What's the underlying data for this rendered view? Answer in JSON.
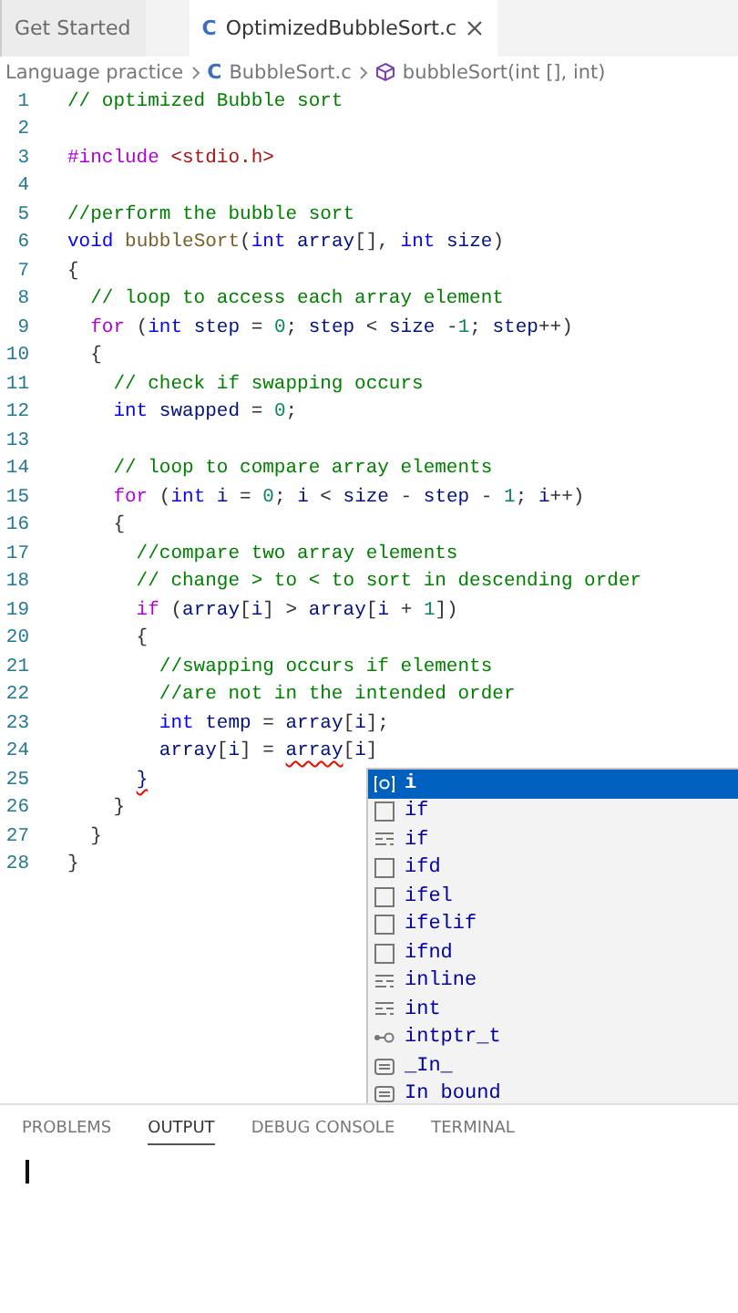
{
  "tabs": [
    {
      "label": "Get Started",
      "selected": false,
      "closable": false
    },
    {
      "label": "OptimizedBubbleSort.c",
      "icon": "C",
      "selected": true,
      "closable": true
    }
  ],
  "breadcrumb": {
    "folder": "Language practice",
    "file_icon": "C",
    "file": "BubbleSort.c",
    "symbol": "bubbleSort(int [], int)"
  },
  "lines": [
    {
      "number": "1",
      "tokens": [
        {
          "kind": "cm",
          "text": "// optimized Bubble sort"
        }
      ]
    },
    {
      "number": "2"
    },
    {
      "number": "3",
      "tokens": [
        {
          "kind": "pp",
          "text": "#include"
        },
        {
          "kind": "str",
          "text": " <stdio.h>"
        }
      ]
    },
    {
      "number": "4"
    },
    {
      "number": "5",
      "tokens": [
        {
          "kind": "cm",
          "text": "//perform the bubble sort"
        }
      ]
    },
    {
      "number": "6",
      "tokens": [
        {
          "kind": "ty",
          "text": "void"
        },
        {
          "kind": "fn",
          "text": " bubbleSort"
        },
        {
          "kind": "tx",
          "text": "("
        },
        {
          "kind": "ty",
          "text": "int"
        },
        {
          "kind": "var",
          "text": " array"
        },
        {
          "kind": "tx",
          "text": "[], "
        },
        {
          "kind": "ty",
          "text": "int"
        },
        {
          "kind": "var",
          "text": " size"
        },
        {
          "kind": "tx",
          "text": ")"
        }
      ]
    },
    {
      "number": "7",
      "tokens": [
        {
          "kind": "tx",
          "text": "{"
        }
      ]
    },
    {
      "number": "8",
      "tokens": [
        {
          "kind": "cm",
          "text": "  // loop to access each array element"
        }
      ]
    },
    {
      "number": "9",
      "tokens": [
        {
          "kind": "kw",
          "text": "  for"
        },
        {
          "kind": "tx",
          "text": " ("
        },
        {
          "kind": "ty",
          "text": "int"
        },
        {
          "kind": "var",
          "text": " step"
        },
        {
          "kind": "tx",
          "text": " = "
        },
        {
          "kind": "num",
          "text": "0"
        },
        {
          "kind": "tx",
          "text": "; "
        },
        {
          "kind": "var",
          "text": "step"
        },
        {
          "kind": "tx",
          "text": " < "
        },
        {
          "kind": "var",
          "text": "size"
        },
        {
          "kind": "tx",
          "text": " -"
        },
        {
          "kind": "num",
          "text": "1"
        },
        {
          "kind": "tx",
          "text": "; "
        },
        {
          "kind": "var",
          "text": "step"
        },
        {
          "kind": "tx",
          "text": "++)"
        }
      ]
    },
    {
      "number": "10",
      "tokens": [
        {
          "kind": "tx",
          "text": "  {"
        }
      ]
    },
    {
      "number": "11",
      "tokens": [
        {
          "kind": "cm",
          "text": "    // check if swapping occurs"
        }
      ]
    },
    {
      "number": "12",
      "tokens": [
        {
          "kind": "ty",
          "text": "    int"
        },
        {
          "kind": "var",
          "text": " swapped"
        },
        {
          "kind": "tx",
          "text": " = "
        },
        {
          "kind": "num",
          "text": "0"
        },
        {
          "kind": "tx",
          "text": ";"
        }
      ]
    },
    {
      "number": "13"
    },
    {
      "number": "14",
      "tokens": [
        {
          "kind": "cm",
          "text": "    // loop to compare array elements"
        }
      ]
    },
    {
      "number": "15",
      "tokens": [
        {
          "kind": "kw",
          "text": "    for"
        },
        {
          "kind": "tx",
          "text": " ("
        },
        {
          "kind": "ty",
          "text": "int"
        },
        {
          "kind": "var",
          "text": " i"
        },
        {
          "kind": "tx",
          "text": " = "
        },
        {
          "kind": "num",
          "text": "0"
        },
        {
          "kind": "tx",
          "text": "; "
        },
        {
          "kind": "var",
          "text": "i"
        },
        {
          "kind": "tx",
          "text": " < "
        },
        {
          "kind": "var",
          "text": "size"
        },
        {
          "kind": "tx",
          "text": " - "
        },
        {
          "kind": "var",
          "text": "step"
        },
        {
          "kind": "tx",
          "text": " - "
        },
        {
          "kind": "num",
          "text": "1"
        },
        {
          "kind": "tx",
          "text": "; "
        },
        {
          "kind": "var",
          "text": "i"
        },
        {
          "kind": "tx",
          "text": "++)"
        }
      ]
    },
    {
      "number": "16",
      "tokens": [
        {
          "kind": "tx",
          "text": "    {"
        }
      ]
    },
    {
      "number": "17",
      "tokens": [
        {
          "kind": "cm",
          "text": "      //compare two array elements"
        }
      ]
    },
    {
      "number": "18",
      "tokens": [
        {
          "kind": "cm",
          "text": "      // change > to < to sort in descending order"
        }
      ]
    },
    {
      "number": "19",
      "tokens": [
        {
          "kind": "kw",
          "text": "      if"
        },
        {
          "kind": "tx",
          "text": " ("
        },
        {
          "kind": "var",
          "text": "array"
        },
        {
          "kind": "tx",
          "text": "["
        },
        {
          "kind": "var",
          "text": "i"
        },
        {
          "kind": "tx",
          "text": "] > "
        },
        {
          "kind": "var",
          "text": "array"
        },
        {
          "kind": "tx",
          "text": "["
        },
        {
          "kind": "var",
          "text": "i"
        },
        {
          "kind": "tx",
          "text": " + "
        },
        {
          "kind": "num",
          "text": "1"
        },
        {
          "kind": "tx",
          "text": "])"
        }
      ]
    },
    {
      "number": "20",
      "tokens": [
        {
          "kind": "tx",
          "text": "      {"
        }
      ]
    },
    {
      "number": "21",
      "tokens": [
        {
          "kind": "cm",
          "text": "        //swapping occurs if elements"
        }
      ]
    },
    {
      "number": "22",
      "tokens": [
        {
          "kind": "cm",
          "text": "        //are not in the intended order"
        }
      ]
    },
    {
      "number": "23",
      "tokens": [
        {
          "kind": "ty",
          "text": "        int"
        },
        {
          "kind": "var",
          "text": " temp"
        },
        {
          "kind": "tx",
          "text": " = "
        },
        {
          "kind": "var",
          "text": "array"
        },
        {
          "kind": "tx",
          "text": "["
        },
        {
          "kind": "var",
          "text": "i"
        },
        {
          "kind": "tx",
          "text": "];"
        }
      ]
    },
    {
      "number": "24",
      "tokens": [
        {
          "kind": "var",
          "text": "        array"
        },
        {
          "kind": "tx",
          "text": "["
        },
        {
          "kind": "var",
          "text": "i"
        },
        {
          "kind": "tx",
          "text": "] = "
        },
        {
          "kind": "err",
          "text": "array"
        },
        {
          "kind": "tx",
          "text": "["
        },
        {
          "kind": "var",
          "text": "i"
        },
        {
          "kind": "tx",
          "text": "]"
        }
      ]
    },
    {
      "number": "25",
      "tokens": [
        {
          "kind": "err",
          "text": "      }"
        }
      ]
    },
    {
      "number": "26",
      "tokens": [
        {
          "kind": "tx",
          "text": "    }"
        }
      ]
    },
    {
      "number": "27",
      "tokens": [
        {
          "kind": "tx",
          "text": "  }"
        }
      ]
    },
    {
      "number": "28",
      "tokens": [
        {
          "kind": "tx",
          "text": "}"
        }
      ]
    }
  ],
  "suggestions": [
    {
      "label": "i",
      "kind": "variable",
      "selected": true
    },
    {
      "label": "if",
      "kind": "snippet",
      "selected": false
    },
    {
      "label": "if",
      "kind": "keyword",
      "selected": false
    },
    {
      "label": "ifd",
      "kind": "snippet",
      "selected": false
    },
    {
      "label": "ifel",
      "kind": "snippet",
      "selected": false
    },
    {
      "label": "ifelif",
      "kind": "snippet",
      "selected": false
    },
    {
      "label": "ifnd",
      "kind": "snippet",
      "selected": false
    },
    {
      "label": "inline",
      "kind": "keyword",
      "selected": false
    },
    {
      "label": "int",
      "kind": "keyword",
      "selected": false
    },
    {
      "label": "intptr_t",
      "kind": "typedef",
      "selected": false
    },
    {
      "label": "_In_",
      "kind": "text",
      "selected": false
    },
    {
      "label": "In bound",
      "kind": "text",
      "selected": false
    }
  ],
  "panel_tabs": [
    {
      "label": "PROBLEMS",
      "selected": false
    },
    {
      "label": "OUTPUT",
      "selected": true
    },
    {
      "label": "DEBUG CONSOLE",
      "selected": false
    },
    {
      "label": "TERMINAL",
      "selected": false
    }
  ]
}
